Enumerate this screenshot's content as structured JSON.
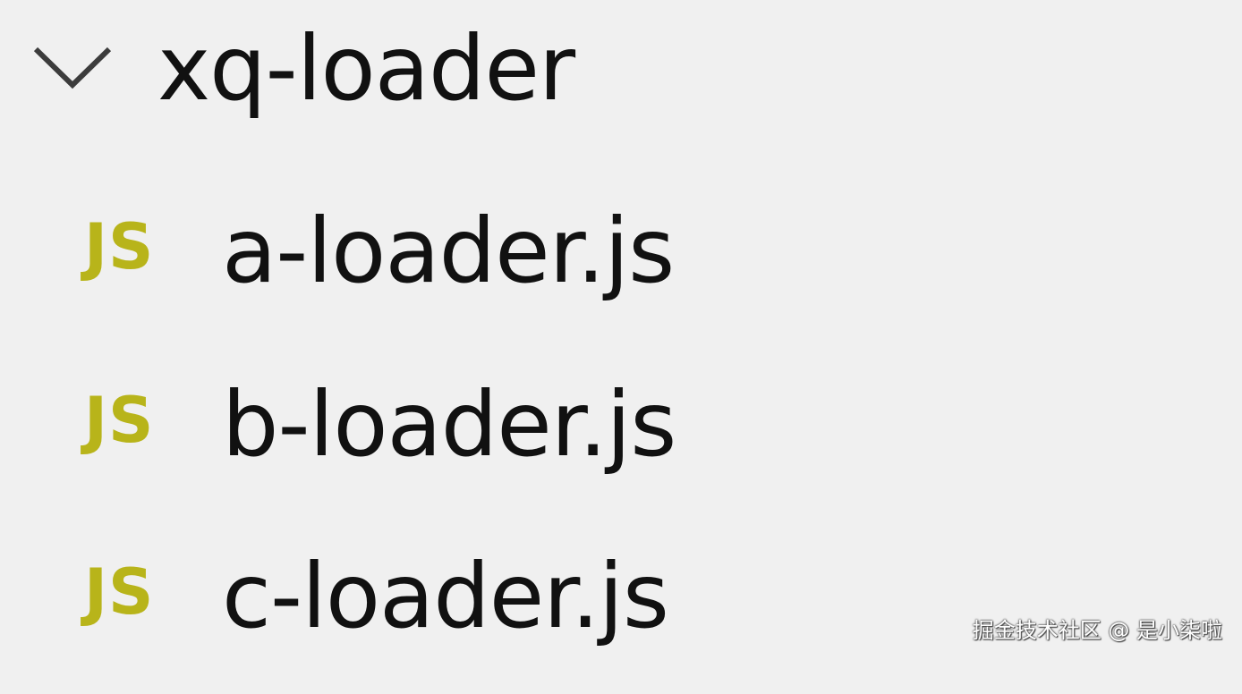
{
  "explorer": {
    "folder": {
      "name": "xq-loader",
      "expanded": true,
      "chevron_icon": "chevron-down-icon"
    },
    "files": [
      {
        "icon_text": "JS",
        "name": "a-loader.js"
      },
      {
        "icon_text": "JS",
        "name": "b-loader.js"
      },
      {
        "icon_text": "JS",
        "name": "c-loader.js"
      }
    ]
  },
  "watermark": "掘金技术社区 @ 是小柒啦",
  "colors": {
    "background": "#f0f0f0",
    "text": "#111111",
    "js_icon": "#b8b41a",
    "chevron": "#3c3c3c"
  }
}
